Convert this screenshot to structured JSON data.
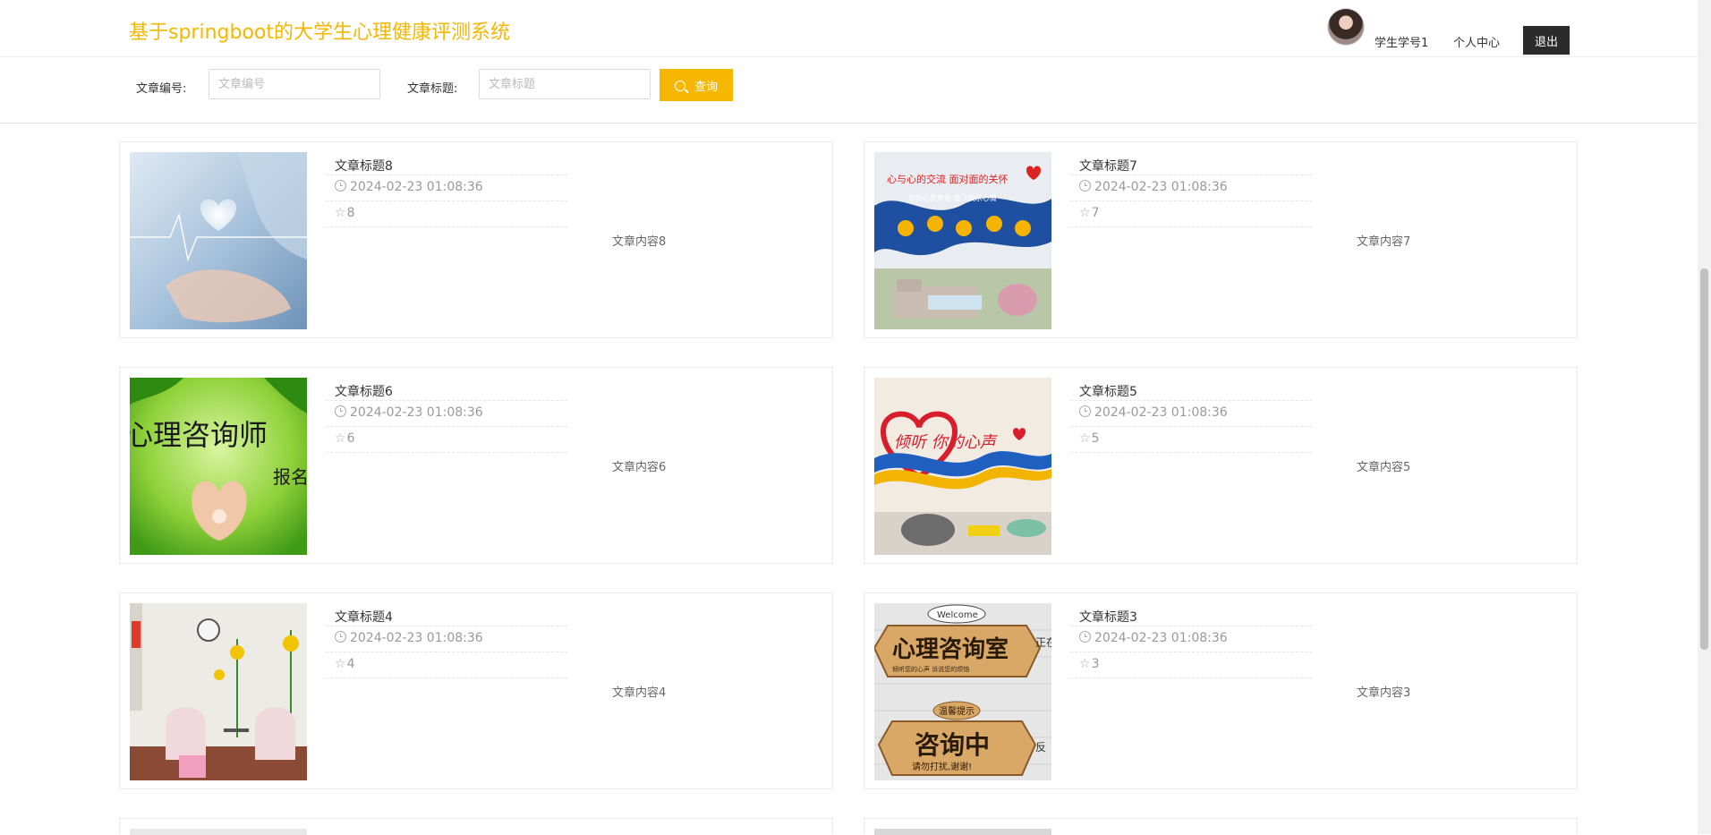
{
  "header": {
    "site_title": "基于springboot的大学生心理健康评测系统",
    "username": "学生学号1",
    "center_link": "个人中心",
    "logout_label": "退出"
  },
  "search": {
    "number_label": "文章编号:",
    "number_placeholder": "文章编号",
    "title_label": "文章标题:",
    "title_placeholder": "文章标题",
    "button_label": "查询"
  },
  "articles": [
    {
      "title": "文章标题8",
      "date": "2024-02-23 01:08:36",
      "likes": "8",
      "content": "文章内容8"
    },
    {
      "title": "文章标题7",
      "date": "2024-02-23 01:08:36",
      "likes": "7",
      "content": "文章内容7"
    },
    {
      "title": "文章标题6",
      "date": "2024-02-23 01:08:36",
      "likes": "6",
      "content": "文章内容6"
    },
    {
      "title": "文章标题5",
      "date": "2024-02-23 01:08:36",
      "likes": "5",
      "content": "文章内容5"
    },
    {
      "title": "文章标题4",
      "date": "2024-02-23 01:08:36",
      "likes": "4",
      "content": "文章内容4"
    },
    {
      "title": "文章标题3",
      "date": "2024-02-23 01:08:36",
      "likes": "3",
      "content": "文章内容3"
    }
  ],
  "thumb_texts": {
    "a6": "心理咨询师",
    "a6_tail": "报名",
    "a5": "倾听 你的心声",
    "a7_top": "心与心的交流  面对面的关怀",
    "a7_band": "聆听心灵声音  放飞快乐心情",
    "a3_welcome": "Welcome",
    "a3_main": "心理咨询室",
    "a3_side": "正在",
    "a3_sub": "倾听您的心声 诉说您的烦恼",
    "a3_tip": "温馨提示",
    "a3_busy": "咨询中",
    "a3_bottom": "请勿打扰,谢谢!",
    "a3_side2": "反"
  },
  "colors": {
    "accent": "#f5b700",
    "dark_button": "#2b2b2b",
    "muted_text": "#999999"
  }
}
